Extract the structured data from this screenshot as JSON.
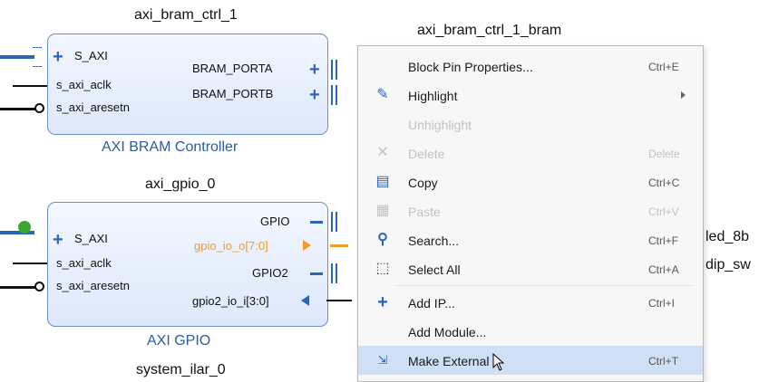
{
  "canvas": {
    "blocks": [
      {
        "name": "axi_bram_ctrl_1",
        "subtitle": "AXI BRAM Controller",
        "left_ports": [
          "S_AXI",
          "s_axi_aclk",
          "s_axi_aresetn"
        ],
        "right_ports": [
          "BRAM_PORTA",
          "BRAM_PORTB"
        ]
      },
      {
        "name": "axi_gpio_0",
        "subtitle": "AXI GPIO",
        "left_ports": [
          "S_AXI",
          "s_axi_aclk",
          "s_axi_aresetn"
        ],
        "right_ports": [
          "GPIO",
          "gpio_io_o[7:0]",
          "GPIO2",
          "gpio2_io_i[3:0]"
        ]
      }
    ],
    "bram_label": "axi_bram_ctrl_1_bram",
    "right_labels": [
      "led_8b",
      "dip_sw"
    ],
    "bottom_partial_label": "system_ilar_0"
  },
  "context_menu": {
    "items": [
      {
        "label": "Block Pin Properties...",
        "shortcut": "Ctrl+E",
        "icon": "none",
        "enabled": true
      },
      {
        "label": "Highlight",
        "shortcut": "",
        "icon": "highlight-icon",
        "enabled": true,
        "submenu": true
      },
      {
        "label": "Unhighlight",
        "shortcut": "",
        "icon": "none",
        "enabled": false
      },
      {
        "label": "Delete",
        "shortcut": "Delete",
        "icon": "delete-icon",
        "enabled": false
      },
      {
        "label": "Copy",
        "shortcut": "Ctrl+C",
        "icon": "copy-icon",
        "enabled": true
      },
      {
        "label": "Paste",
        "shortcut": "Ctrl+V",
        "icon": "paste-icon",
        "enabled": false
      },
      {
        "label": "Search...",
        "shortcut": "Ctrl+F",
        "icon": "search-icon",
        "enabled": true
      },
      {
        "label": "Select All",
        "shortcut": "Ctrl+A",
        "icon": "select-all-icon",
        "enabled": true
      },
      {
        "label": "Add IP...",
        "shortcut": "Ctrl+I",
        "icon": "plus-icon",
        "enabled": true
      },
      {
        "label": "Add Module...",
        "shortcut": "",
        "icon": "none",
        "enabled": true
      },
      {
        "label": "Make External",
        "shortcut": "Ctrl+T",
        "icon": "make-external-icon",
        "enabled": true,
        "selected": true
      }
    ]
  },
  "colors": {
    "block_border": "#6e8fc6",
    "interface_blue": "#2c64b7",
    "subtitle_blue": "#2d5c9c",
    "orange_port": "#f39a2b",
    "menu_selected": "#cfe0f6"
  }
}
